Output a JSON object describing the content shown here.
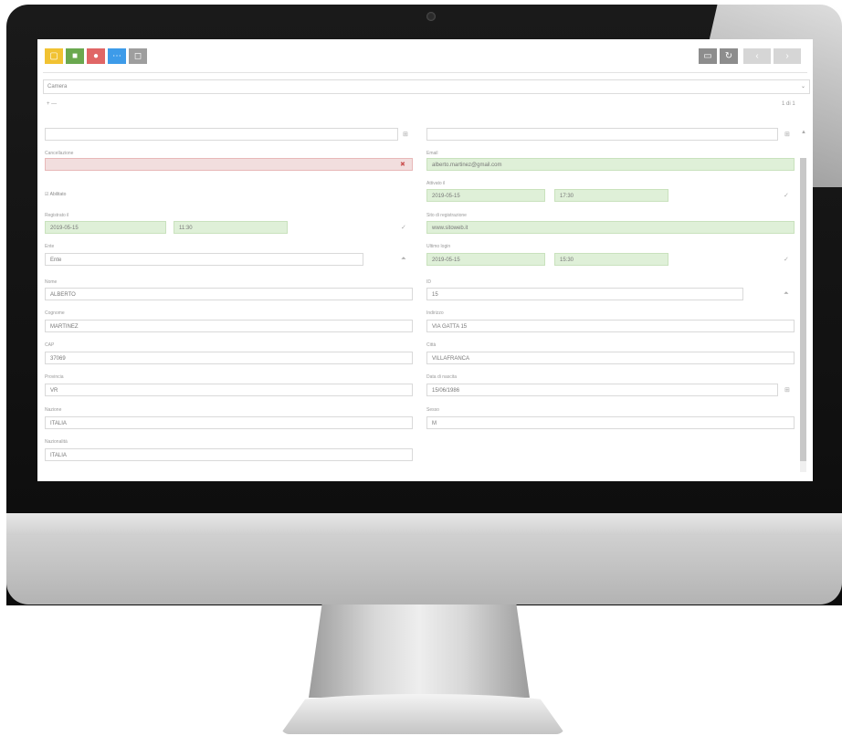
{
  "toolbar": {
    "left_buttons": [
      {
        "icon": "folder-icon",
        "color": "#f1c232"
      },
      {
        "icon": "save-icon",
        "color": "#6aa84f"
      },
      {
        "icon": "delete-icon",
        "color": "#e06666"
      },
      {
        "icon": "more-icon",
        "color": "#3d9be9"
      },
      {
        "icon": "refresh-icon",
        "color": "#9e9e9e"
      }
    ],
    "right_buttons": [
      {
        "icon": "message-icon",
        "color": "#8d8d8d"
      },
      {
        "icon": "sync-icon",
        "color": "#8d8d8d"
      },
      {
        "icon": "prev-icon",
        "color": "#d6d6d6"
      },
      {
        "icon": "next-icon",
        "color": "#d6d6d6"
      }
    ]
  },
  "select": {
    "value": "Camera"
  },
  "nav": {
    "left": "+  —",
    "right": "1 di 1"
  },
  "form": {
    "left": {
      "field0": {
        "value": ""
      },
      "cancellazione": {
        "label": "Cancellazione",
        "value": ""
      },
      "abilitato": {
        "label": "Abilitato"
      },
      "registrato": {
        "label": "Registrato il",
        "date": "2019-05-15",
        "time": "11:30"
      },
      "ente": {
        "label": "Ente",
        "placeholder": "Ente"
      },
      "nome": {
        "label": "Nome",
        "value": "ALBERTO"
      },
      "cognome": {
        "label": "Cognome",
        "value": "MARTINEZ"
      },
      "cap": {
        "label": "CAP",
        "value": "37069"
      },
      "provincia": {
        "label": "Provincia",
        "value": "VR"
      },
      "nazione": {
        "label": "Nazione",
        "value": "ITALIA"
      },
      "nazionalita": {
        "label": "Nazionalità",
        "value": "ITALIA"
      }
    },
    "right": {
      "field0": {
        "value": ""
      },
      "email": {
        "label": "Email",
        "value": "alberto.martinez@gmail.com"
      },
      "attivato": {
        "label": "Attivato il",
        "date": "2019-05-15",
        "time": "17:30"
      },
      "sito": {
        "label": "Sito di registrazione",
        "value": "www.sitoweb.it"
      },
      "ultimo": {
        "label": "Ultimo login",
        "date": "2019-05-15",
        "time": "15:30"
      },
      "id": {
        "label": "ID",
        "value": "15"
      },
      "indirizzo": {
        "label": "Indirizzo",
        "value": "VIA GATTA 15"
      },
      "citta": {
        "label": "Città",
        "value": "VILLAFRANCA"
      },
      "nascita": {
        "label": "Data di nascita",
        "value": "15/06/1986"
      },
      "sesso": {
        "label": "Sesso",
        "value": "M"
      }
    }
  },
  "colors": {
    "accent_ok": "#dff0d8",
    "accent_err": "#f2dede"
  }
}
